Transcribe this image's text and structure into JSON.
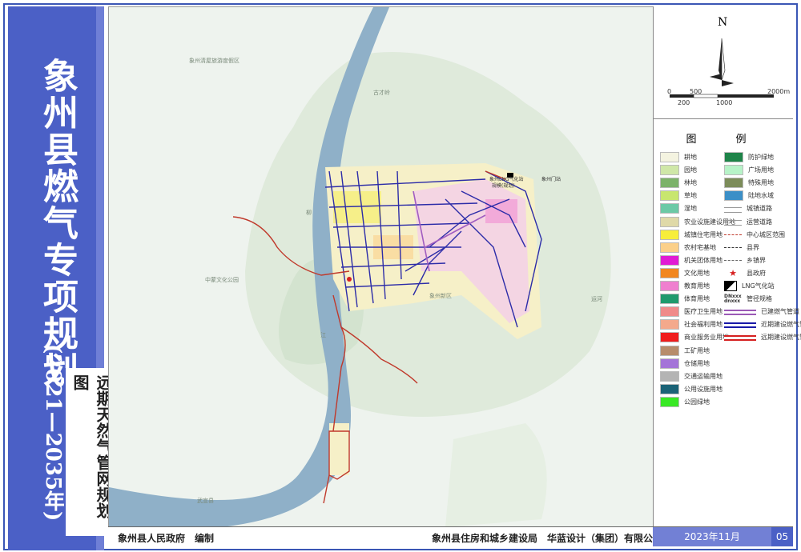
{
  "title": {
    "main": "象州县燃气专项规划",
    "year": "(2021—2035年)",
    "subtitle": "远期天然气管网规划图"
  },
  "footer": {
    "left": "象州县人民政府　编制",
    "right": "象州县住房和城乡建设局　华蓝设计（集团）有限公司　制图",
    "date": "2023年11月",
    "page": "05"
  },
  "north_arrow": {
    "letter": "N",
    "scale_top": [
      "0",
      "500",
      "2000m"
    ],
    "scale_bottom": [
      "200",
      "1000"
    ]
  },
  "legend": {
    "title": "图　例",
    "left": [
      {
        "label": "耕地",
        "color": "#f4f3e0"
      },
      {
        "label": "园地",
        "color": "#cfe7a8"
      },
      {
        "label": "林地",
        "color": "#7cb26a"
      },
      {
        "label": "草地",
        "color": "#c8e66e"
      },
      {
        "label": "湿地",
        "color": "#6cc9a6"
      },
      {
        "label": "农业设施建设用地",
        "color": "#dfd9a8"
      },
      {
        "label": "城镇住宅用地",
        "color": "#f7ee3b"
      },
      {
        "label": "农村宅基地",
        "color": "#fbd08a"
      },
      {
        "label": "机关团体用地",
        "color": "#e11bd4"
      },
      {
        "label": "文化用地",
        "color": "#f2861f"
      },
      {
        "label": "教育用地",
        "color": "#ef7fcf"
      },
      {
        "label": "体育用地",
        "color": "#1f9a6d"
      },
      {
        "label": "医疗卫生用地",
        "color": "#f08a8a"
      },
      {
        "label": "社会福利用地",
        "color": "#f4a98c"
      },
      {
        "label": "商业服务业用地",
        "color": "#f01c1c"
      },
      {
        "label": "工矿用地",
        "color": "#b78c6b"
      },
      {
        "label": "仓储用地",
        "color": "#a474d8"
      },
      {
        "label": "交通运输用地",
        "color": "#b4b4b4"
      },
      {
        "label": "公用设施用地",
        "color": "#1b6377"
      },
      {
        "label": "公园绿地",
        "color": "#38e824"
      }
    ],
    "right": [
      {
        "label": "防护绿地",
        "symbol": "fill",
        "color": "#1e8449"
      },
      {
        "label": "广场用地",
        "symbol": "fill",
        "color": "#b7f3c8"
      },
      {
        "label": "特殊用地",
        "symbol": "fill",
        "color": "#7c8c5a"
      },
      {
        "label": "陆地水域",
        "symbol": "fill",
        "color": "#3b8fc7"
      },
      {
        "label": "城镇道路",
        "symbol": "road",
        "color": "#cccccc"
      },
      {
        "label": "运营道路",
        "symbol": "road",
        "color": "#cccccc"
      },
      {
        "label": "中心城区范围",
        "symbol": "dash",
        "color": "#c0392b"
      },
      {
        "label": "县界",
        "symbol": "dashdot",
        "color": "#333333"
      },
      {
        "label": "乡镇界",
        "symbol": "dash",
        "color": "#666666"
      },
      {
        "label": "县政府",
        "symbol": "star",
        "color": "#d62020"
      },
      {
        "label": "LNG气化站",
        "symbol": "station",
        "color": "#000000"
      },
      {
        "label": "管径规格",
        "symbol": "dn",
        "color": "#000000",
        "code_top": "DNxxx",
        "code_bottom": "dnxxx"
      },
      {
        "label": "已建燃气管道",
        "symbol": "pipe",
        "color": "#9b59b6"
      },
      {
        "label": "近期建设燃气管道",
        "symbol": "pipe",
        "color": "#1a1aa8"
      },
      {
        "label": "远期建设燃气管道",
        "symbol": "pipe",
        "color": "#d62020"
      }
    ]
  },
  "map": {
    "labels": [
      "象州清屋旅游度假区",
      "古才岭",
      "中蒙文化公园",
      "象州新区",
      "武宣县",
      "柳",
      "江",
      "象州LNG气化站",
      "象州门站",
      "规模(规划)",
      "运河"
    ],
    "river_color": "#8fb0c8",
    "pipe_far_color": "#c0392b",
    "pipe_near_color": "#2c2ca8",
    "pipe_built_color": "#a05cc0"
  }
}
